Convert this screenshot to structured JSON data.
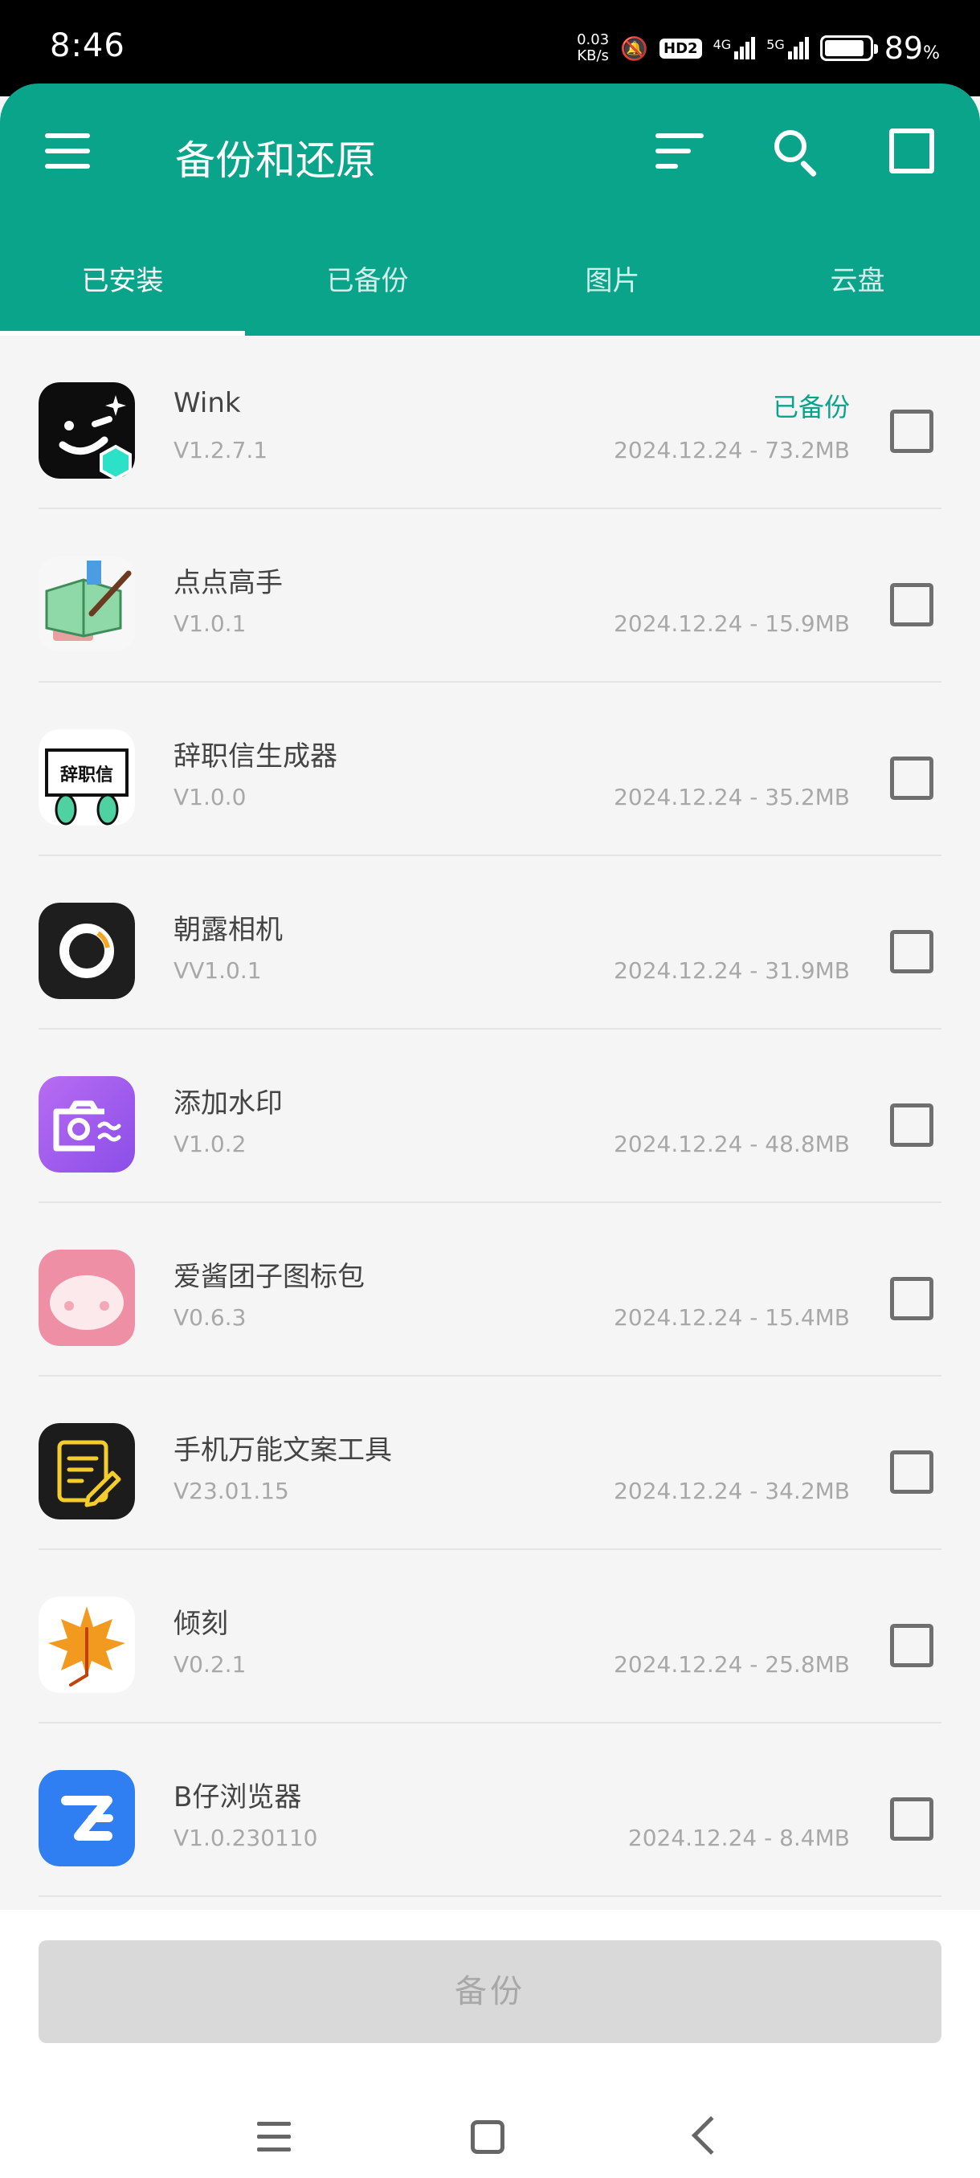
{
  "status_bar": {
    "time": "8:46",
    "speed_value": "0.03",
    "speed_unit": "KB/s",
    "hd_label": "HD2",
    "net1": "4G",
    "net2": "5G",
    "battery_pct": "89",
    "battery_sym": "%",
    "battery_level": 0.89
  },
  "header": {
    "title": "备份和还原",
    "icons": [
      "menu-icon",
      "sort-icon",
      "search-icon",
      "select-all-checkbox"
    ]
  },
  "tabs": [
    {
      "label": "已安装",
      "active": true
    },
    {
      "label": "已备份",
      "active": false
    },
    {
      "label": "图片",
      "active": false
    },
    {
      "label": "云盘",
      "active": false
    }
  ],
  "apps": [
    {
      "name": "Wink",
      "version": "V1.2.7.1",
      "status": "已备份",
      "meta": "2024.12.24 - 73.2MB"
    },
    {
      "name": "点点高手",
      "version": "V1.0.1",
      "status": "",
      "meta": "2024.12.24 - 15.9MB"
    },
    {
      "name": "辞职信生成器",
      "version": "V1.0.0",
      "status": "",
      "meta": "2024.12.24 - 35.2MB",
      "icon_text": "辞职信"
    },
    {
      "name": "朝露相机",
      "version": "VV1.0.1",
      "status": "",
      "meta": "2024.12.24 - 31.9MB"
    },
    {
      "name": "添加水印",
      "version": "V1.0.2",
      "status": "",
      "meta": "2024.12.24 - 48.8MB"
    },
    {
      "name": "爱酱团子图标包",
      "version": "V0.6.3",
      "status": "",
      "meta": "2024.12.24 - 15.4MB"
    },
    {
      "name": "手机万能文案工具",
      "version": "V23.01.15",
      "status": "",
      "meta": "2024.12.24 - 34.2MB"
    },
    {
      "name": "倾刻",
      "version": "V0.2.1",
      "status": "",
      "meta": "2024.12.24 - 25.8MB"
    },
    {
      "name": "B仔浏览器",
      "version": "V1.0.230110",
      "status": "",
      "meta": "2024.12.24 - 8.4MB"
    }
  ],
  "footer": {
    "backup_label": "备份"
  },
  "colors": {
    "accent": "#0aa48b",
    "status_backed_up": "#0aa48b"
  }
}
